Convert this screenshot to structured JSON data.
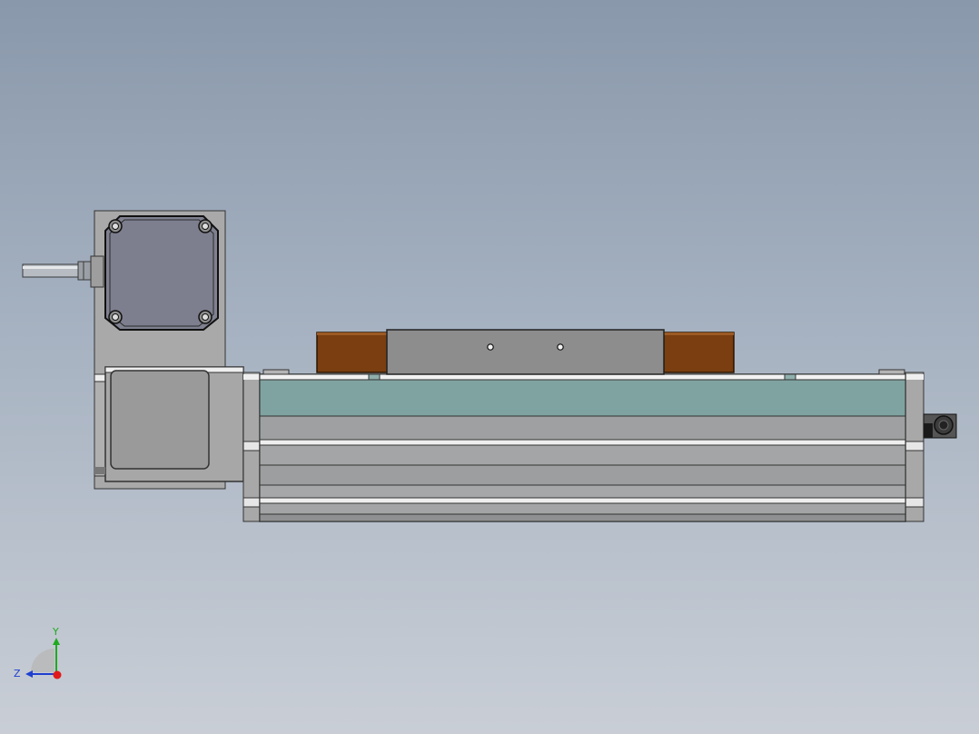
{
  "viewport": {
    "background_top": "#8998ab",
    "background_bottom": "#c9ced6"
  },
  "model": {
    "plate_color": "#a9a9a9",
    "motor_color": "#7d7f8f",
    "rail_top_color": "#7fa3a0",
    "rail_body_color": "#a0a2a3",
    "carriage_color": "#8d8d8d",
    "block_color": "#7a3e10"
  },
  "triad": {
    "y_label": "Y",
    "z_label": "Z",
    "y_color": "#1faa1f",
    "z_color": "#1f3fd0",
    "x_color": "#e01a1a"
  }
}
